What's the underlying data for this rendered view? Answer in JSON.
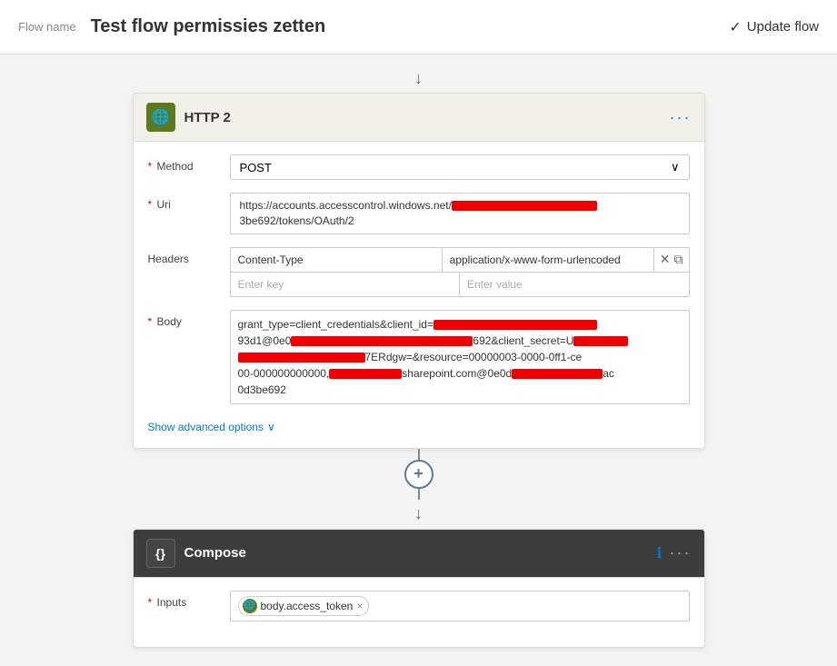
{
  "header": {
    "flow_label": "Flow name",
    "flow_name": "Test flow permissies zetten",
    "update_btn_label": "Update flow",
    "check_icon": "✓"
  },
  "http_card": {
    "title": "HTTP 2",
    "icon": "🌐",
    "menu_icon": "···",
    "method_label": "Method",
    "method_value": "POST",
    "method_required": true,
    "uri_label": "Uri",
    "uri_required": true,
    "uri_prefix": "https://accounts.accesscontrol.windows.net/",
    "uri_suffix": "3be692/tokens/OAuth/2",
    "headers_label": "Headers",
    "headers_key1": "Content-Type",
    "headers_val1": "application/x-www-form-urlencoded",
    "headers_key_placeholder": "Enter key",
    "headers_val_placeholder": "Enter value",
    "body_label": "Body",
    "body_required": true,
    "body_line1_prefix": "grant_type=client_credentials&client_id=",
    "body_line2": "93d1@0e0",
    "body_line2_suffix": "692&client_secret=U",
    "body_line3_suffix": "7ERdgw=&resource=00000003-0000-0ff1-ce",
    "body_line4": "00-000000000000,",
    "body_line4_mid": "sharepoint.com@0e0d",
    "body_line4_suffix": "ac",
    "body_line5": "0d3be692",
    "advanced_link": "Show advanced options",
    "chevron": "∨"
  },
  "compose_card": {
    "title": "Compose",
    "icon": "{}",
    "menu_icon": "···",
    "info_icon": "ℹ",
    "inputs_label": "Inputs",
    "inputs_required": true,
    "token_label": "body.access_token",
    "token_icon": "🌐",
    "token_close": "×"
  },
  "arrows": {
    "down": "↓",
    "plus": "+"
  }
}
